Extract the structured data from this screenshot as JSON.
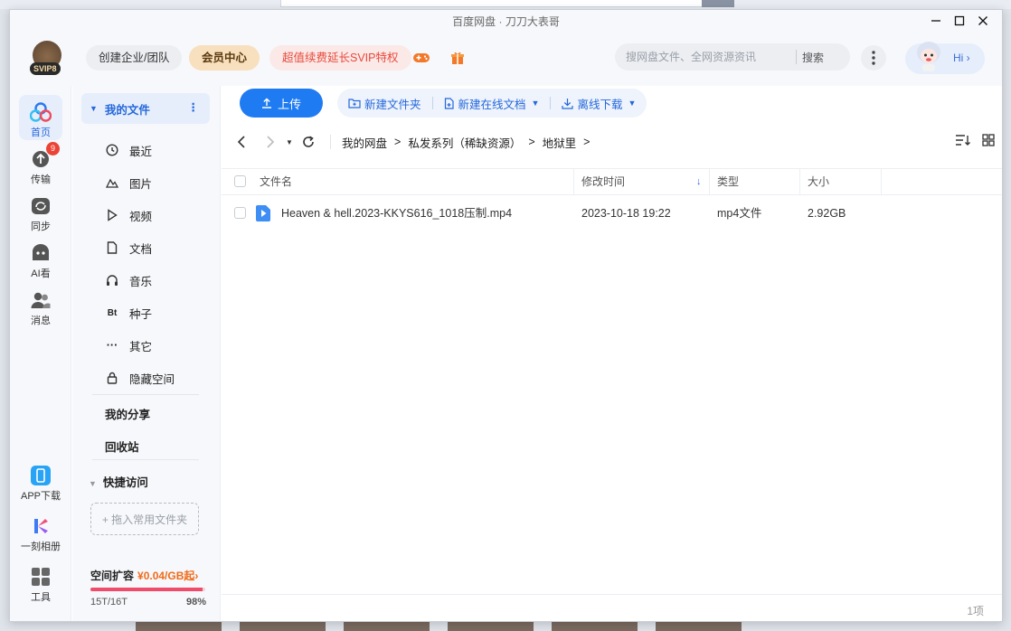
{
  "window": {
    "title": "百度网盘 · 刀刀大表哥"
  },
  "header": {
    "svip_badge": "SVIP8",
    "team_button": "创建企业/团队",
    "member_button": "会员中心",
    "svip_promo": "超值续费延长SVIP特权",
    "search_placeholder": "搜网盘文件、全网资源资讯",
    "search_button": "搜索",
    "hi_label": "Hi"
  },
  "rail": {
    "items": [
      {
        "label": "首页"
      },
      {
        "label": "传输",
        "badge": "9"
      },
      {
        "label": "同步"
      },
      {
        "label": "AI看"
      },
      {
        "label": "消息"
      }
    ],
    "bottom": [
      {
        "label": "APP下载"
      },
      {
        "label": "一刻相册"
      },
      {
        "label": "工具"
      }
    ]
  },
  "sidebar": {
    "my_files": "我的文件",
    "categories": [
      {
        "label": "最近",
        "icon": "clock-icon"
      },
      {
        "label": "图片",
        "icon": "image-icon"
      },
      {
        "label": "视频",
        "icon": "play-icon"
      },
      {
        "label": "文档",
        "icon": "document-icon"
      },
      {
        "label": "音乐",
        "icon": "headphones-icon"
      },
      {
        "label": "种子",
        "icon": "bt-icon"
      },
      {
        "label": "其它",
        "icon": "ellipsis-icon"
      },
      {
        "label": "隐藏空间",
        "icon": "lock-icon"
      }
    ],
    "my_share": "我的分享",
    "recycle_bin": "回收站",
    "quick_access": "快捷访问",
    "drop_hint": "+ 拖入常用文件夹",
    "storage": {
      "title": "空间扩容",
      "price": "¥0.04/GB起",
      "used_text": "15T/16T",
      "percent_text": "98%",
      "percent_value": 98
    }
  },
  "toolbar": {
    "upload": "上传",
    "new_folder": "新建文件夹",
    "new_doc": "新建在线文档",
    "offline_download": "离线下载"
  },
  "breadcrumb": [
    "我的网盘",
    "私发系列（稀缺资源）",
    "地狱里"
  ],
  "table": {
    "headers": {
      "name": "文件名",
      "modified": "修改时间",
      "type": "类型",
      "size": "大小"
    },
    "rows": [
      {
        "name": "Heaven & hell.2023-KKYS616_1018压制.mp4",
        "modified": "2023-10-18 19:22",
        "type": "mp4文件",
        "size": "2.92GB"
      }
    ]
  },
  "footer": {
    "count": "1项"
  },
  "colors": {
    "accent": "#1f7bf2",
    "badge": "#ea4436",
    "promo": "#e8493c",
    "storage_bar": "#ef4b6a"
  }
}
